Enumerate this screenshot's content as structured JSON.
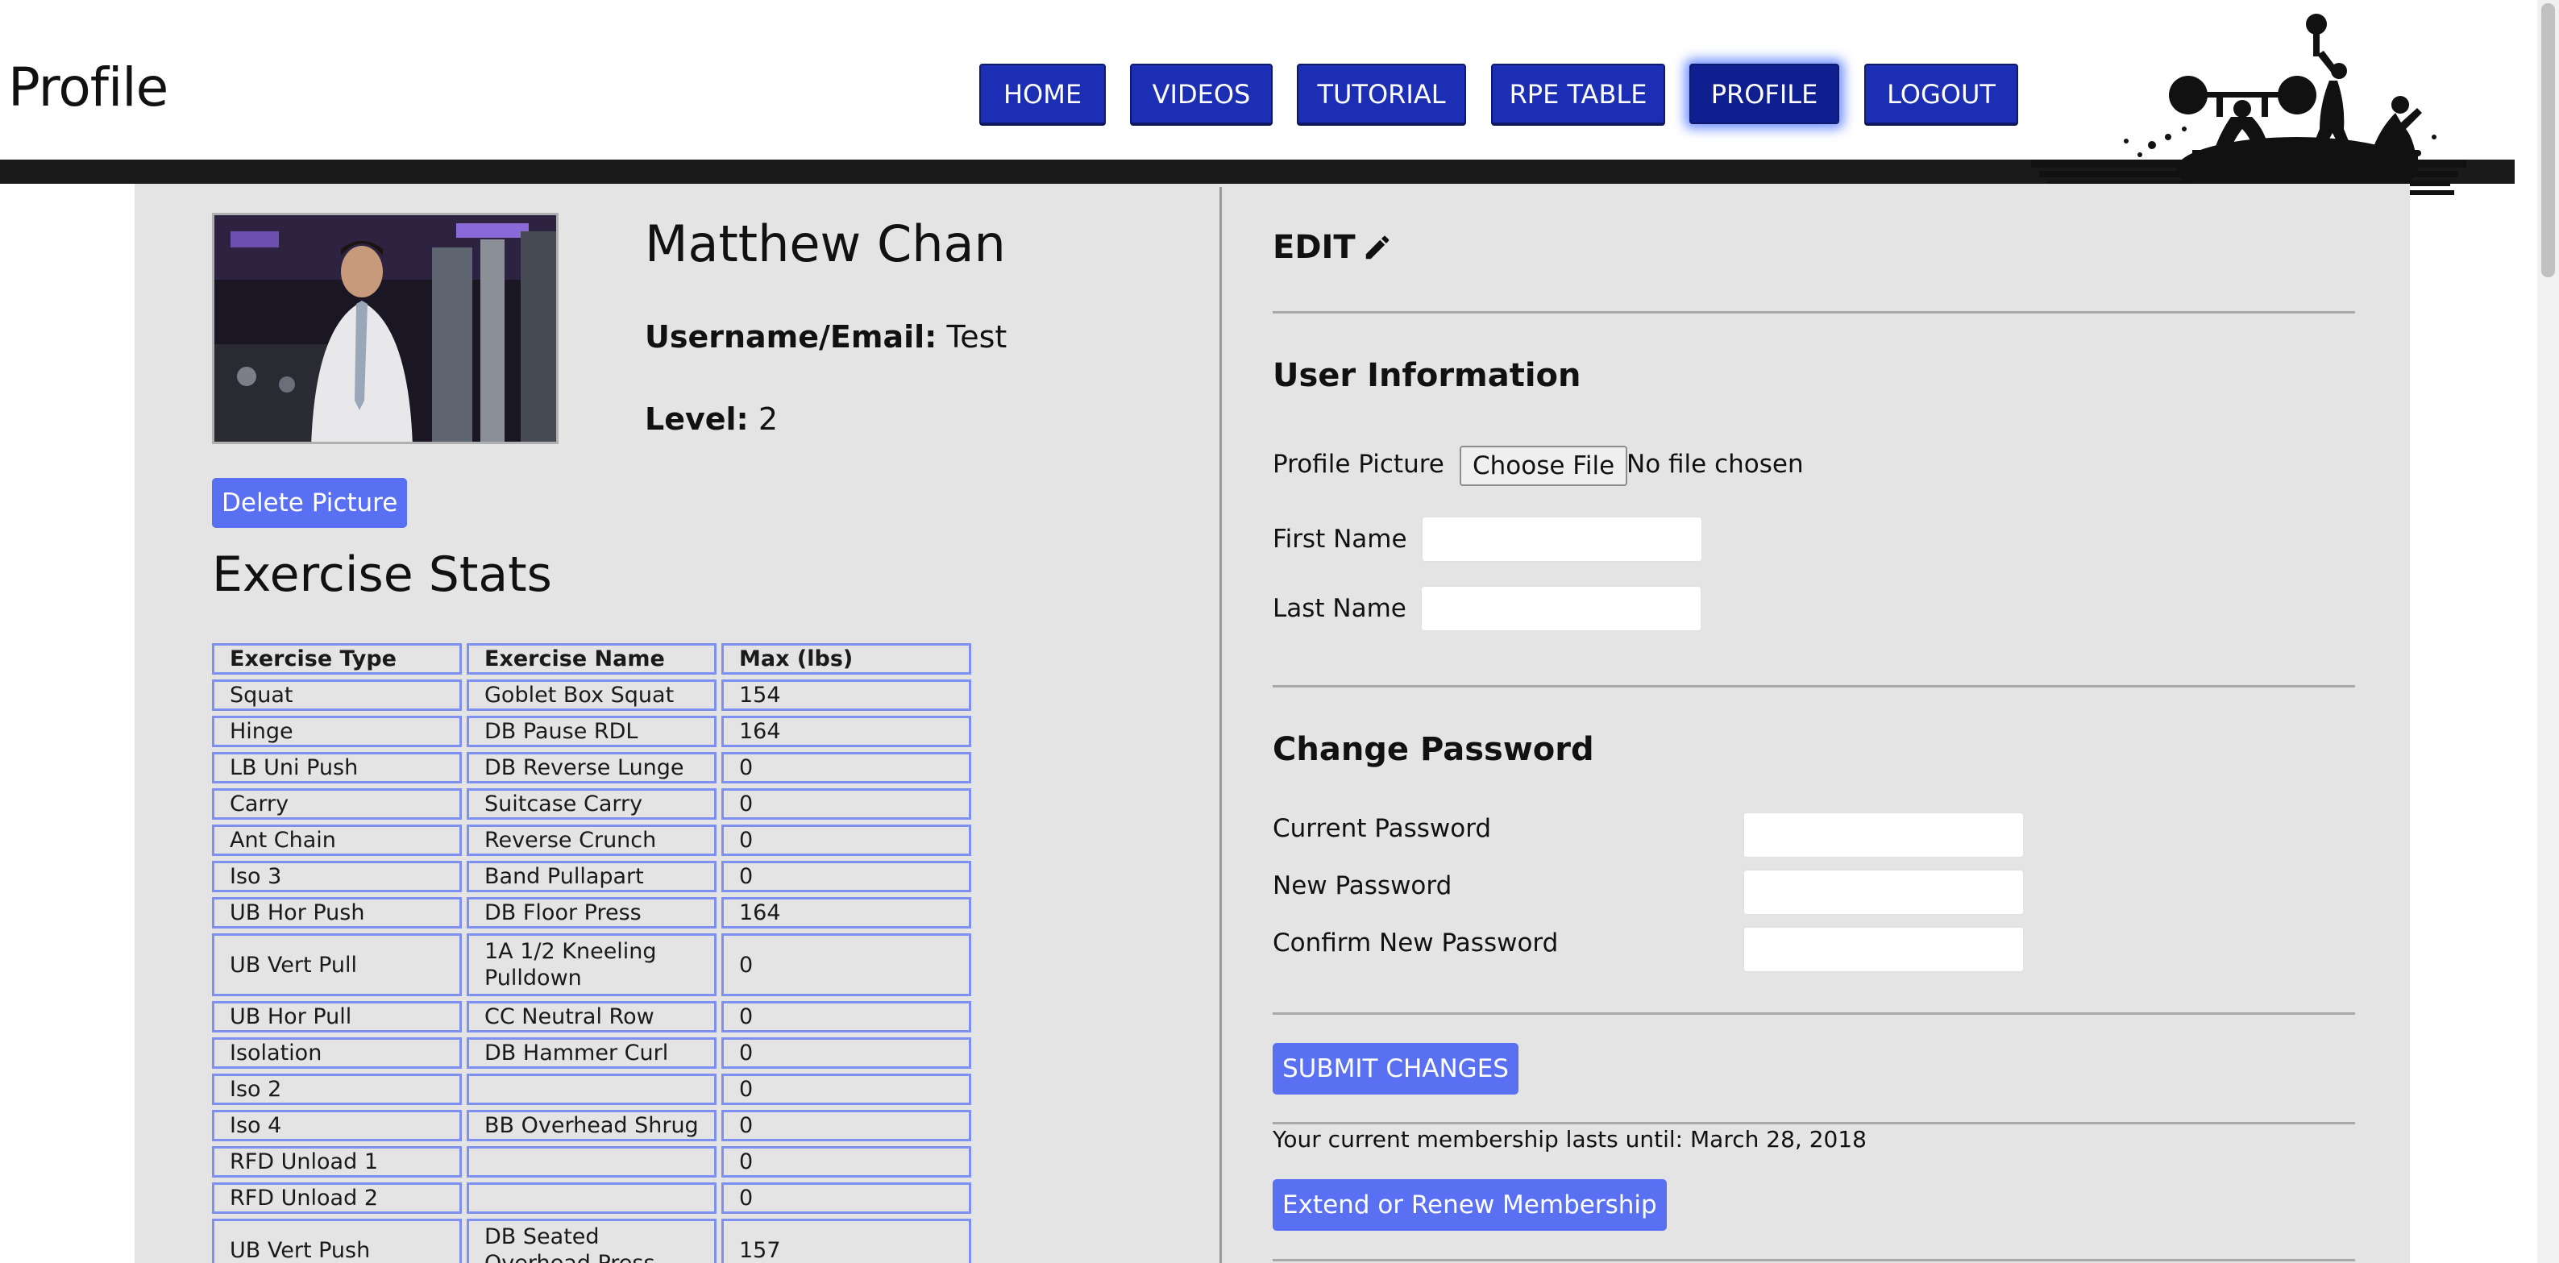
{
  "header": {
    "title": "Profile",
    "nav": [
      {
        "label": "HOME"
      },
      {
        "label": "VIDEOS"
      },
      {
        "label": "TUTORIAL"
      },
      {
        "label": "RPE TABLE"
      },
      {
        "label": "PROFILE",
        "active": true
      },
      {
        "label": "LOGOUT"
      }
    ]
  },
  "profile": {
    "name": "Matthew Chan",
    "username_label": "Username/Email:",
    "username_value": "Test",
    "level_label": "Level:",
    "level_value": "2",
    "delete_picture_label": "Delete Picture"
  },
  "stats": {
    "title": "Exercise Stats",
    "columns": [
      "Exercise Type",
      "Exercise Name",
      "Max (lbs)"
    ],
    "rows": [
      [
        "Squat",
        "Goblet Box Squat",
        "154"
      ],
      [
        "Hinge",
        "DB Pause RDL",
        "164"
      ],
      [
        "LB Uni Push",
        "DB Reverse Lunge",
        "0"
      ],
      [
        "Carry",
        "Suitcase Carry",
        "0"
      ],
      [
        "Ant Chain",
        "Reverse Crunch",
        "0"
      ],
      [
        "Iso 3",
        "Band Pullapart",
        "0"
      ],
      [
        "UB Hor Push",
        "DB Floor Press",
        "164"
      ],
      [
        "UB Vert Pull",
        "1A 1/2 Kneeling Pulldown",
        "0"
      ],
      [
        "UB Hor Pull",
        "CC Neutral Row",
        "0"
      ],
      [
        "Isolation",
        "DB Hammer Curl",
        "0"
      ],
      [
        "Iso 2",
        "",
        "0"
      ],
      [
        "Iso 4",
        "BB Overhead Shrug",
        "0"
      ],
      [
        "RFD Unload 1",
        "",
        "0"
      ],
      [
        "RFD Unload 2",
        "",
        "0"
      ],
      [
        "UB Vert Push",
        "DB Seated Overhead Press",
        "157"
      ]
    ]
  },
  "edit": {
    "title": "EDIT",
    "icon": "pencil-icon",
    "user_info_title": "User Information",
    "profile_picture_label": "Profile Picture",
    "choose_file_label": "Choose File",
    "file_status": "No file chosen",
    "first_name_label": "First Name",
    "first_name_value": "",
    "last_name_label": "Last Name",
    "last_name_value": "",
    "change_password_title": "Change Password",
    "current_password_label": "Current Password",
    "new_password_label": "New Password",
    "confirm_password_label": "Confirm New Password",
    "submit_label": "SUBMIT CHANGES",
    "membership_text": "Your current membership lasts until: March 28, 2018",
    "extend_label": "Extend or Renew Membership"
  },
  "colors": {
    "nav_button": "#1c2fb4",
    "accent_button": "#5a70f2",
    "panel_bg": "#e4e4e4",
    "table_border": "#7d8ff0"
  }
}
